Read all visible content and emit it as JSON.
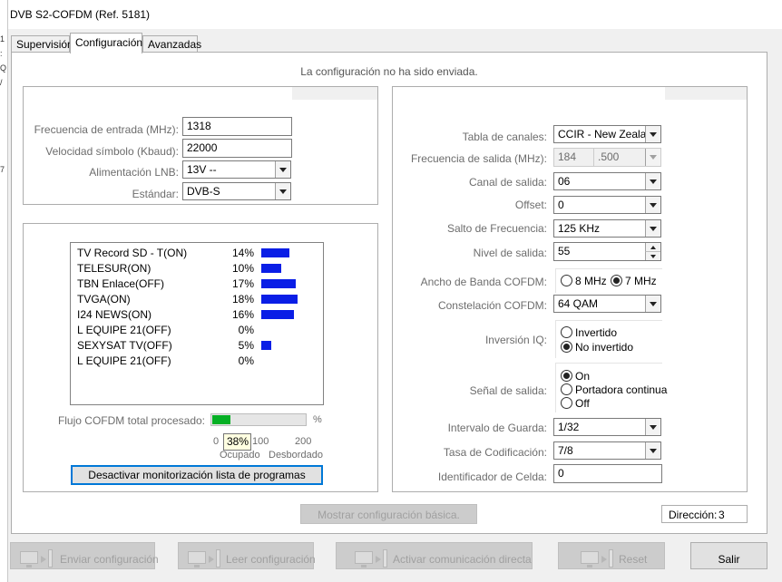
{
  "window": {
    "title": "DVB S2-COFDM (Ref. 5181)"
  },
  "tabs": [
    {
      "label": "Supervisión"
    },
    {
      "label": "Configuración"
    },
    {
      "label": "Avanzadas"
    }
  ],
  "status_message": "La configuración no ha sido enviada.",
  "input_group": {
    "frecuencia_entrada": {
      "label": "Frecuencia de entrada (MHz):",
      "value": "1318"
    },
    "velocidad_simbolo": {
      "label": "Velocidad símbolo (Kbaud):",
      "value": "22000"
    },
    "alimentacion_lnb": {
      "label": "Alimentación LNB:",
      "value": "13V --"
    },
    "estandar": {
      "label": "Estándar:",
      "value": "DVB-S"
    }
  },
  "programs": [
    {
      "name": "TV Record SD - T(ON)",
      "pct_label": "14%",
      "pct": 14
    },
    {
      "name": "TELESUR(ON)",
      "pct_label": "10%",
      "pct": 10
    },
    {
      "name": "TBN Enlace(OFF)",
      "pct_label": "17%",
      "pct": 17
    },
    {
      "name": "TVGA(ON)",
      "pct_label": "18%",
      "pct": 18
    },
    {
      "name": "I24 NEWS(ON)",
      "pct_label": "16%",
      "pct": 16
    },
    {
      "name": "L EQUIPE 21(OFF)",
      "pct_label": "0%",
      "pct": 0
    },
    {
      "name": "SEXYSAT TV(OFF)",
      "pct_label": "5%",
      "pct": 5
    },
    {
      "name": "L EQUIPE 21(OFF)",
      "pct_label": "0%",
      "pct": 0
    }
  ],
  "flujo": {
    "label": "Flujo COFDM total procesado:",
    "unit": "%",
    "fill_pct": 38,
    "tooltip": "38%",
    "scale_0": "0",
    "scale_100": "100",
    "scale_200": "200",
    "ocupado": "Ocupado",
    "desbordado": "Desbordado"
  },
  "monitor_button": "Desactivar monitorización lista de programas",
  "output_group": {
    "tabla_canales": {
      "label": "Tabla de canales:",
      "value": "CCIR - New Zealand"
    },
    "frecuencia_salida": {
      "label": "Frecuencia de salida (MHz):",
      "value_int": "184",
      "value_dec": ".500"
    },
    "canal_salida": {
      "label": "Canal de salida:",
      "value": "06"
    },
    "offset": {
      "label": "Offset:",
      "value": "0"
    },
    "salto_frecuencia": {
      "label": "Salto de Frecuencia:",
      "value": "125 KHz"
    },
    "nivel_salida": {
      "label": "Nivel de salida:",
      "value": "55"
    },
    "ancho_banda": {
      "label": "Ancho de Banda COFDM:",
      "opt1": "8 MHz",
      "opt2": "7 MHz",
      "selected": "7 MHz"
    },
    "constelacion": {
      "label": "Constelación COFDM:",
      "value": "64 QAM"
    },
    "inversion_iq": {
      "label": "Inversión IQ:",
      "opt1": "Invertido",
      "opt2": "No invertido",
      "selected": "No invertido"
    },
    "senal_salida": {
      "label": "Señal de salida:",
      "opt1": "On",
      "opt2": "Portadora continua",
      "opt3": "Off",
      "selected": "On"
    },
    "intervalo_guarda": {
      "label": "Intervalo de Guarda:",
      "value": "1/32"
    },
    "tasa_codificacion": {
      "label": "Tasa de Codificación:",
      "value": "7/8"
    },
    "identificador_celda": {
      "label": "Identificador de Celda:",
      "value": "0"
    }
  },
  "mostrar_basica_button": "Mostrar configuración básica.",
  "direccion": {
    "label": "Dirección:",
    "value": "3"
  },
  "bottom_buttons": {
    "enviar": "Enviar configuración",
    "leer": "Leer configuración",
    "activar": "Activar comunicación directa",
    "reset": "Reset",
    "salir": "Salir"
  }
}
